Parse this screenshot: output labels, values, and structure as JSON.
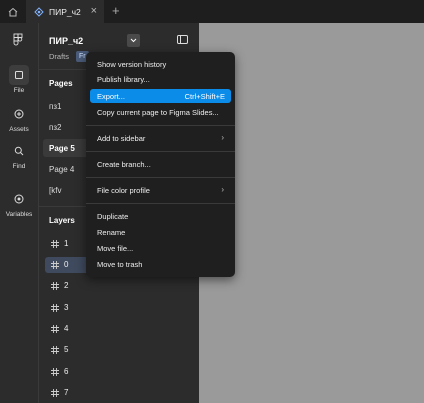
{
  "tabs": {
    "active_title": "ПИР_ч2",
    "close_glyph": "×",
    "new_glyph": "+"
  },
  "rail": [
    {
      "label": "File",
      "icon": "file-icon",
      "active": true
    },
    {
      "label": "Assets",
      "icon": "assets-icon"
    },
    {
      "label": "Find",
      "icon": "search-icon"
    },
    {
      "label": "Variables",
      "icon": "variables-icon"
    }
  ],
  "panel": {
    "file_title": "ПИР_ч2",
    "drafts_label": "Drafts",
    "plan_badge": "Fr",
    "pages_title": "Pages",
    "pages": [
      {
        "label": "пз1",
        "selected": false
      },
      {
        "label": "пз2",
        "selected": false
      },
      {
        "label": "Page 5",
        "selected": true
      },
      {
        "label": "Page 4",
        "selected": false
      },
      {
        "label": "[kfv",
        "selected": false
      }
    ],
    "layers_title": "Layers",
    "layers": [
      {
        "label": "1",
        "selected": false
      },
      {
        "label": "0",
        "selected": true
      },
      {
        "label": "2",
        "selected": false
      },
      {
        "label": "3",
        "selected": false
      },
      {
        "label": "4",
        "selected": false
      },
      {
        "label": "5",
        "selected": false
      },
      {
        "label": "6",
        "selected": false
      },
      {
        "label": "7",
        "selected": false
      }
    ]
  },
  "menu": {
    "items": {
      "version_history": "Show version history",
      "publish_library": "Publish library...",
      "export": "Export...",
      "export_shortcut": "Ctrl+Shift+E",
      "copy_to_slides": "Copy current page to Figma Slides...",
      "add_to_sidebar": "Add to sidebar",
      "create_branch": "Create branch...",
      "color_profile": "File color profile",
      "duplicate": "Duplicate",
      "rename": "Rename",
      "move_file": "Move file...",
      "move_to_trash": "Move to trash"
    },
    "highlight_color": "#0c8ce9"
  },
  "colors": {
    "canvas": "#9a9a9a",
    "panel": "#2c2c2c",
    "topbar": "#1e1e1e",
    "menu": "#1f1f1f"
  }
}
